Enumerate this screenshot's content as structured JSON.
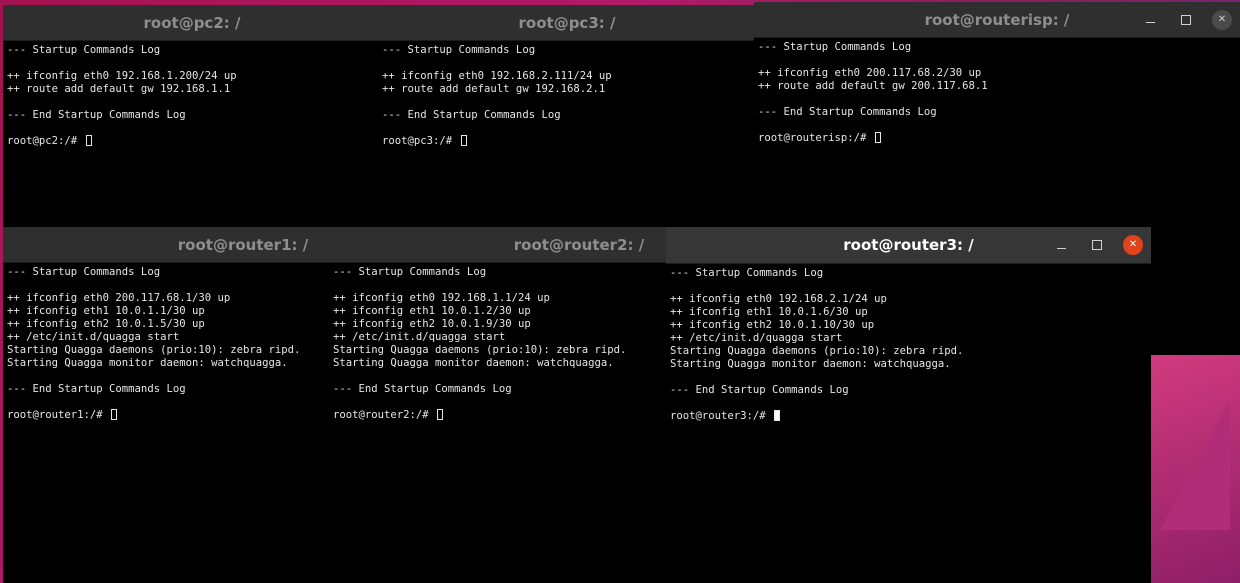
{
  "windows": {
    "pc2": {
      "title": "root@pc2: /",
      "lines": [
        "--- Startup Commands Log",
        "",
        "++ ifconfig eth0 192.168.1.200/24 up",
        "++ route add default gw 192.168.1.1",
        "",
        "--- End Startup Commands Log",
        ""
      ],
      "prompt": "root@pc2:/# "
    },
    "pc3": {
      "title": "root@pc3: /",
      "lines": [
        "--- Startup Commands Log",
        "",
        "++ ifconfig eth0 192.168.2.111/24 up",
        "++ route add default gw 192.168.2.1",
        "",
        "--- End Startup Commands Log",
        ""
      ],
      "prompt": "root@pc3:/# "
    },
    "routerisp": {
      "title": "root@routerisp: /",
      "lines": [
        "--- Startup Commands Log",
        "",
        "++ ifconfig eth0 200.117.68.2/30 up",
        "++ route add default gw 200.117.68.1",
        "",
        "--- End Startup Commands Log",
        ""
      ],
      "prompt": "root@routerisp:/# "
    },
    "router1": {
      "title": "root@router1: /",
      "lines": [
        "--- Startup Commands Log",
        "",
        "++ ifconfig eth0 200.117.68.1/30 up",
        "++ ifconfig eth1 10.0.1.1/30 up",
        "++ ifconfig eth2 10.0.1.5/30 up",
        "++ /etc/init.d/quagga start",
        "Starting Quagga daemons (prio:10): zebra ripd.",
        "Starting Quagga monitor daemon: watchquagga.",
        "",
        "--- End Startup Commands Log",
        ""
      ],
      "prompt": "root@router1:/# "
    },
    "router2": {
      "title": "root@router2: /",
      "lines": [
        "--- Startup Commands Log",
        "",
        "++ ifconfig eth0 192.168.1.1/24 up",
        "++ ifconfig eth1 10.0.1.2/30 up",
        "++ ifconfig eth2 10.0.1.9/30 up",
        "++ /etc/init.d/quagga start",
        "Starting Quagga daemons (prio:10): zebra ripd.",
        "Starting Quagga monitor daemon: watchquagga.",
        "",
        "--- End Startup Commands Log",
        ""
      ],
      "prompt": "root@router2:/# "
    },
    "router3": {
      "title": "root@router3: /",
      "lines": [
        "--- Startup Commands Log",
        "",
        "++ ifconfig eth0 192.168.2.1/24 up",
        "++ ifconfig eth1 10.0.1.6/30 up",
        "++ ifconfig eth2 10.0.1.10/30 up",
        "++ /etc/init.d/quagga start",
        "Starting Quagga daemons (prio:10): zebra ripd.",
        "Starting Quagga monitor daemon: watchquagga.",
        "",
        "--- End Startup Commands Log",
        ""
      ],
      "prompt": "root@router3:/# "
    }
  },
  "colors": {
    "titlebar_inactive": "#2f2f2f",
    "titlebar_active": "#363636",
    "close_active": "#e2431d",
    "terminal_bg": "#000000",
    "terminal_fg": "#e6e6e6"
  }
}
